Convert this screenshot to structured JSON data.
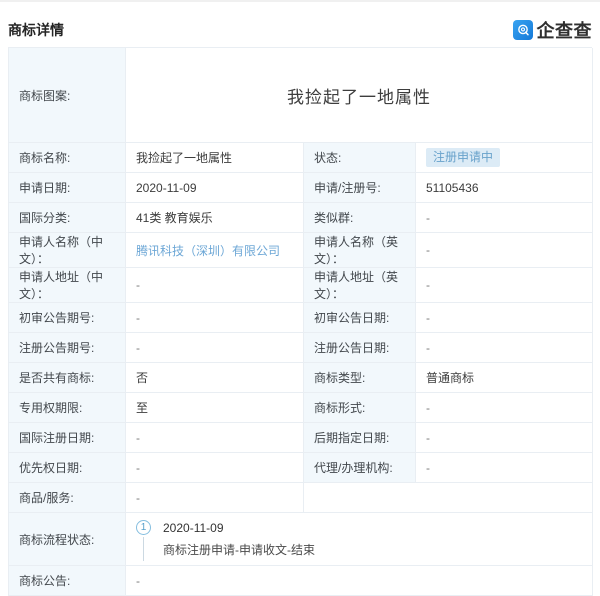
{
  "header": {
    "title": "商标详情",
    "brand_name": "企查查",
    "brand_icon": "qichacha-logo-icon"
  },
  "image_row": {
    "label": "商标图案:",
    "value": "我捡起了一地属性"
  },
  "fields": [
    {
      "left": {
        "label": "商标名称:",
        "value": "我捡起了一地属性"
      },
      "right": {
        "label": "状态:",
        "value": "注册申请中",
        "type": "badge"
      }
    },
    {
      "left": {
        "label": "申请日期:",
        "value": "2020-11-09"
      },
      "right": {
        "label": "申请/注册号:",
        "value": "51105436"
      }
    },
    {
      "left": {
        "label": "国际分类:",
        "value": "41类 教育娱乐"
      },
      "right": {
        "label": "类似群:",
        "value": "-"
      }
    },
    {
      "left": {
        "label": "申请人名称（中文）：",
        "value": "腾讯科技（深圳）有限公司",
        "type": "link"
      },
      "right": {
        "label": "申请人名称（英文）：",
        "value": "-"
      }
    },
    {
      "left": {
        "label": "申请人地址（中文）：",
        "value": "-"
      },
      "right": {
        "label": "申请人地址（英文）：",
        "value": "-"
      }
    },
    {
      "left": {
        "label": "初审公告期号:",
        "value": "-"
      },
      "right": {
        "label": "初审公告日期:",
        "value": "-"
      }
    },
    {
      "left": {
        "label": "注册公告期号:",
        "value": "-"
      },
      "right": {
        "label": "注册公告日期:",
        "value": "-"
      }
    },
    {
      "left": {
        "label": "是否共有商标:",
        "value": "否"
      },
      "right": {
        "label": "商标类型:",
        "value": "普通商标"
      }
    },
    {
      "left": {
        "label": "专用权期限:",
        "value": "至"
      },
      "right": {
        "label": "商标形式:",
        "value": "-"
      }
    },
    {
      "left": {
        "label": "国际注册日期:",
        "value": "-"
      },
      "right": {
        "label": "后期指定日期:",
        "value": "-"
      }
    },
    {
      "left": {
        "label": "优先权日期:",
        "value": "-"
      },
      "right": {
        "label": "代理/办理机构:",
        "value": "-"
      }
    }
  ],
  "goods_row": {
    "label": "商品/服务:",
    "value": "-"
  },
  "process_row": {
    "label": "商标流程状态:",
    "steps": [
      {
        "index": "1",
        "date": "2020-11-09",
        "description": "商标注册申请-申请收文-结束"
      }
    ]
  },
  "announcement_row": {
    "label": "商标公告:",
    "value": "-"
  },
  "colors": {
    "brand_blue": "#2492e8",
    "label_cell_bg": "#f2f8fc",
    "cell_border": "#e9eef3",
    "badge_bg": "#dcebf6",
    "badge_text": "#68a2cb",
    "link_blue": "#6da7d6"
  }
}
